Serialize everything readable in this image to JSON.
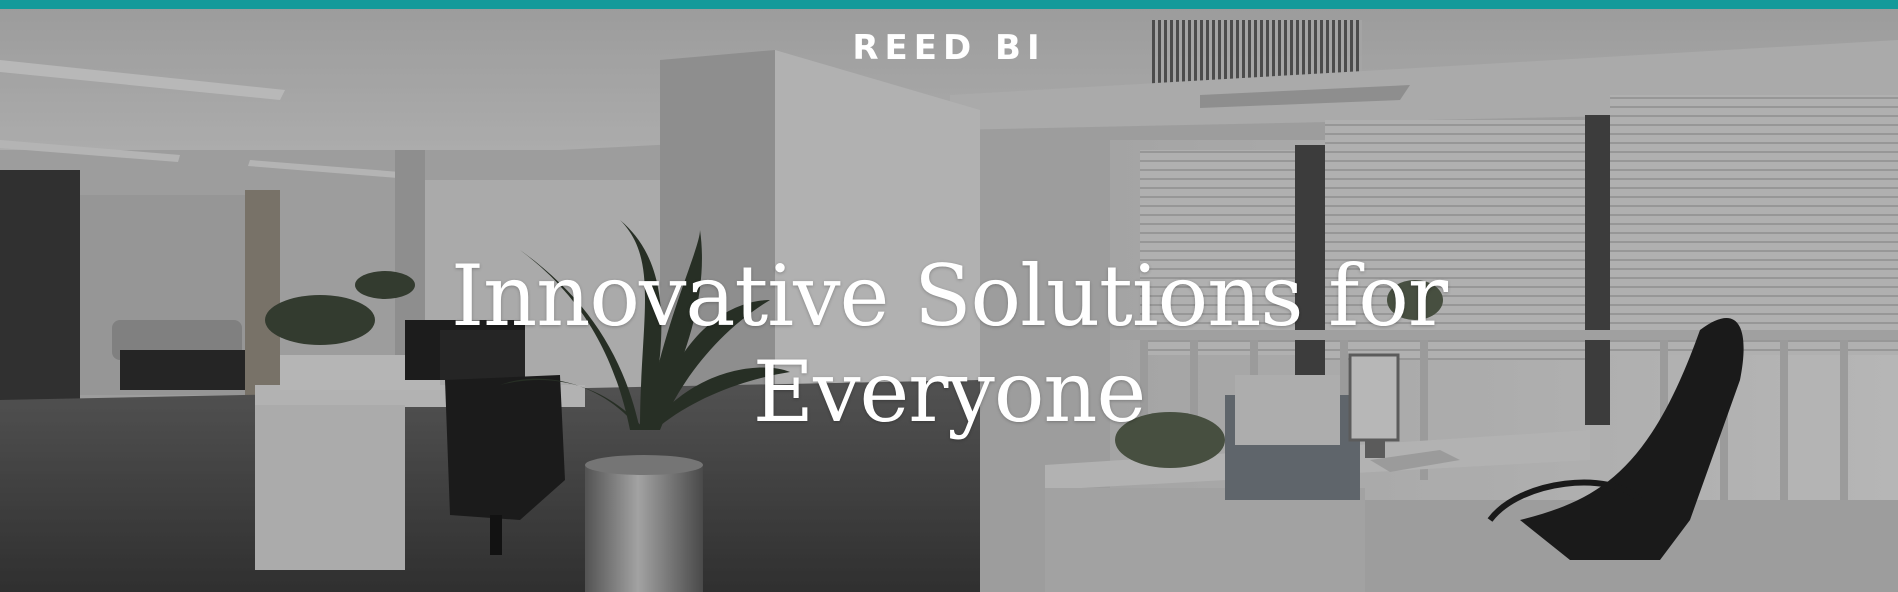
{
  "header": {
    "brand": "REED BI",
    "accent_color": "#139a9a"
  },
  "hero": {
    "title_line_1": "Innovative Solutions for",
    "title_line_2": "Everyone",
    "background_image": "office-interior-photo"
  }
}
